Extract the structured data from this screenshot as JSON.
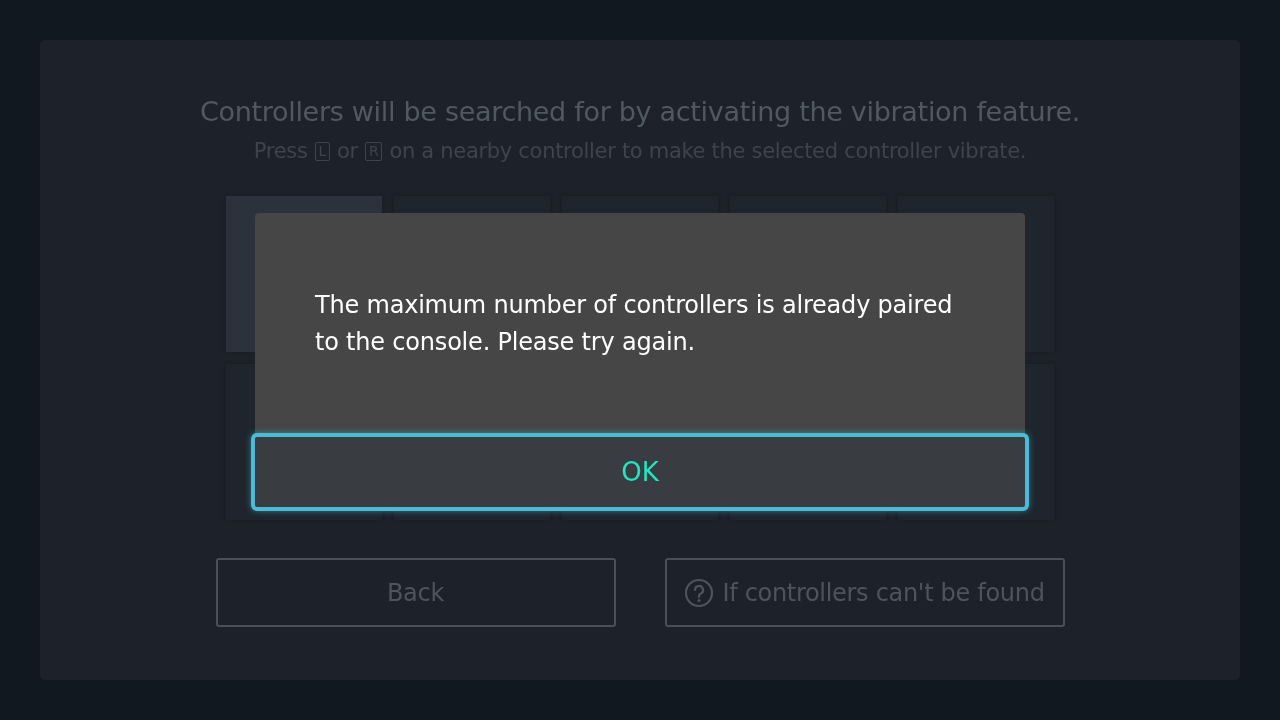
{
  "header": {
    "title": "Controllers will be searched for by activating the vibration feature.",
    "subtitle": [
      {
        "kind": "text",
        "text": "Press"
      },
      {
        "kind": "key",
        "text": "L"
      },
      {
        "kind": "text",
        "text": "or"
      },
      {
        "kind": "key",
        "text": "R"
      },
      {
        "kind": "text",
        "text": "on a nearby controller to make the selected controller vibrate."
      }
    ]
  },
  "slots": [
    {
      "selected": true
    },
    {
      "selected": false
    },
    {
      "selected": false
    },
    {
      "selected": false
    },
    {
      "selected": false
    },
    {
      "selected": false
    },
    {
      "selected": false
    },
    {
      "selected": false
    },
    {
      "selected": false
    },
    {
      "selected": false
    }
  ],
  "buttons": [
    {
      "kind": "back",
      "label": "Back"
    },
    {
      "kind": "help",
      "label": "If controllers can't be found"
    }
  ],
  "dialog": {
    "message": "The maximum number of controllers is already paired to the console. Please try again.",
    "button": {
      "label": "OK",
      "focused": true
    }
  }
}
